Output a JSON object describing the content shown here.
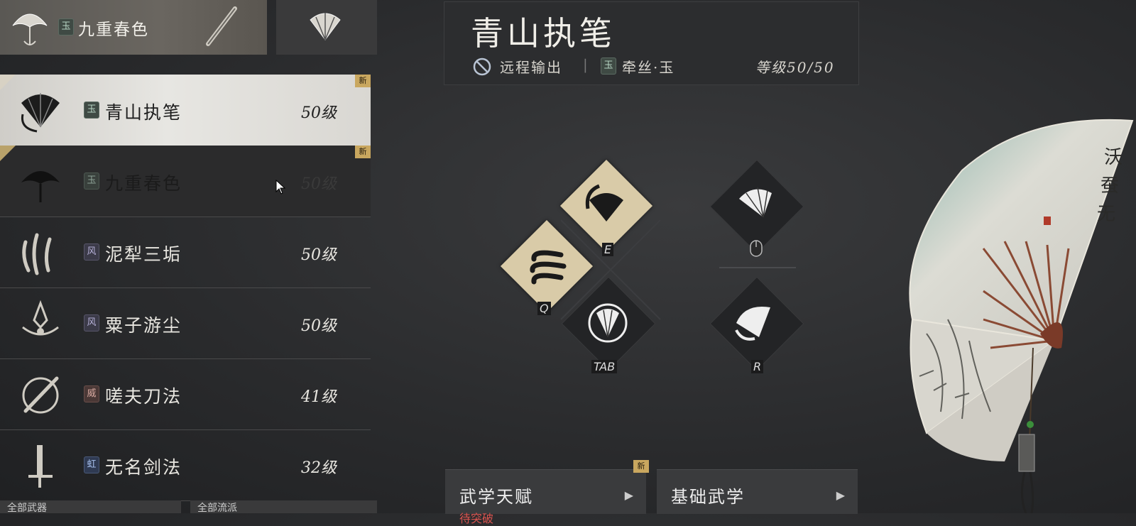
{
  "equipped": {
    "grade": "玉",
    "name": "九重春色"
  },
  "weapon_list": [
    {
      "grade": "玉",
      "grade_type": "jade",
      "name": "青山执笔",
      "level": "50级",
      "new": "新",
      "state": "selected"
    },
    {
      "grade": "玉",
      "grade_type": "jade",
      "name": "九重春色",
      "level": "50级",
      "new": "新",
      "state": "dim"
    },
    {
      "grade": "风",
      "grade_type": "wind",
      "name": "泥犁三垢",
      "level": "50级",
      "new": "",
      "state": "normal"
    },
    {
      "grade": "风",
      "grade_type": "wind",
      "name": "粟子游尘",
      "level": "50级",
      "new": "",
      "state": "normal"
    },
    {
      "grade": "威",
      "grade_type": "might",
      "name": "嗟夫刀法",
      "level": "41级",
      "new": "",
      "state": "normal"
    },
    {
      "grade": "虹",
      "grade_type": "rainbow",
      "name": "无名剑法",
      "level": "32级",
      "new": "",
      "state": "normal"
    }
  ],
  "bottom_tabs": [
    "全部武器",
    "全部流派"
  ],
  "header": {
    "title": "青山执笔",
    "role": "远程输出",
    "separator": "|",
    "school_grade": "玉",
    "school": "牵丝·玉",
    "level_label": "等级50/50"
  },
  "skills": {
    "q": "Q",
    "e": "E",
    "tab": "TAB",
    "r": "R"
  },
  "panels": [
    {
      "label": "武学天赋",
      "new": "新",
      "sub": "待突破"
    },
    {
      "label": "基础武学",
      "new": "",
      "sub": ""
    }
  ],
  "colors": {
    "selected_row": "#e7e6e2",
    "skill_active": "#d9cba8",
    "new_tag": "#c9a75f",
    "warning_text": "#d9534f"
  }
}
